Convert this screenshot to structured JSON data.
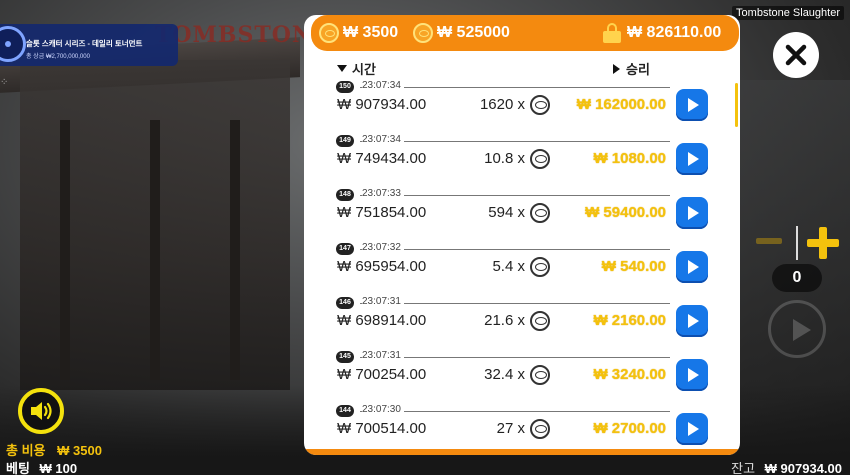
{
  "game_title": "Tombstone Slaughter",
  "tournament": {
    "title": "슬롯 스캐터 시리즈 - 데일리 토너먼트",
    "subtitle": "총 상금 ₩2,700,000,000"
  },
  "game_logo_text": "TOMBSTONE",
  "header": {
    "bet_value": "₩ 3500",
    "total_value": "₩ 525000",
    "locked_value": "₩ 826110.00"
  },
  "columns": {
    "time": "시간",
    "win": "승리"
  },
  "history": [
    {
      "round": "150",
      "time": "23:07:34",
      "balance": "₩ 907934.00",
      "multiplier": "1620 x",
      "win": "₩ 162000.00"
    },
    {
      "round": "149",
      "time": "23:07:34",
      "balance": "₩ 749434.00",
      "multiplier": "10.8 x",
      "win": "₩ 1080.00"
    },
    {
      "round": "148",
      "time": "23:07:33",
      "balance": "₩ 751854.00",
      "multiplier": "594 x",
      "win": "₩ 59400.00"
    },
    {
      "round": "147",
      "time": "23:07:32",
      "balance": "₩ 695954.00",
      "multiplier": "5.4 x",
      "win": "₩ 540.00"
    },
    {
      "round": "146",
      "time": "23:07:31",
      "balance": "₩ 698914.00",
      "multiplier": "21.6 x",
      "win": "₩ 2160.00"
    },
    {
      "round": "145",
      "time": "23:07:31",
      "balance": "₩ 700254.00",
      "multiplier": "32.4 x",
      "win": "₩ 3240.00"
    },
    {
      "round": "144",
      "time": "23:07:30",
      "balance": "₩ 700514.00",
      "multiplier": "27 x",
      "win": "₩ 2700.00"
    }
  ],
  "counter_value": "0",
  "footer": {
    "total_cost_label": "총 비용",
    "total_cost_value": "₩ 3500",
    "bet_label": "베팅",
    "bet_value": "₩ 100",
    "balance_label": "잔고",
    "balance_value": "₩ 907934.00"
  },
  "colors": {
    "accent_orange": "#f48a0f",
    "win_yellow": "#f4c20d",
    "play_blue": "#1677e8"
  },
  "icons": {
    "coin": "coin-icon",
    "lock": "lock-icon",
    "close": "close-icon",
    "sound": "speaker-icon",
    "play": "play-icon"
  }
}
